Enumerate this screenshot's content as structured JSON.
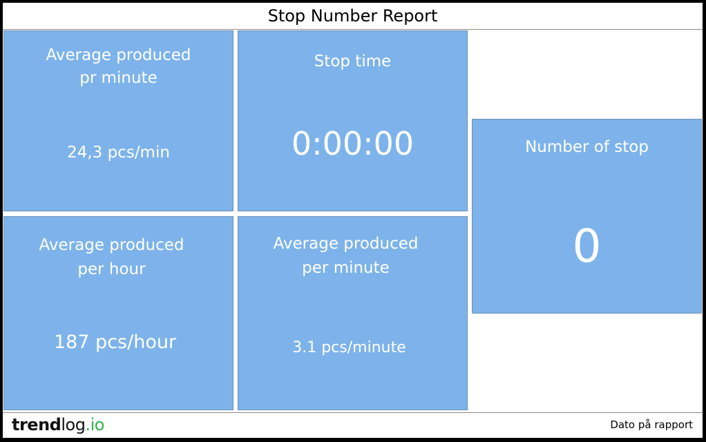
{
  "header": {
    "title": "Stop Number Report"
  },
  "tiles": {
    "avg_pr_minute": {
      "title": "Average produced pr minute",
      "value": "24,3 pcs/min"
    },
    "stop_time": {
      "title": "Stop time",
      "value": "0:00:00"
    },
    "number_of_stop": {
      "title": "Number of stop",
      "value": "0"
    },
    "avg_per_hour": {
      "title": "Average produced per hour",
      "value": "187 pcs/hour"
    },
    "avg_per_minute": {
      "title": "Average produced per minute",
      "value": "3.1 pcs/minute"
    }
  },
  "footer": {
    "logo": {
      "trend": "trend",
      "log": "log",
      "dot": ".",
      "io": "io"
    },
    "date_label": "Dato på rapport"
  },
  "colors": {
    "tile_background": "#7db3ea",
    "tile_text": "#ffffff",
    "logo_accent": "#2fb34a"
  }
}
